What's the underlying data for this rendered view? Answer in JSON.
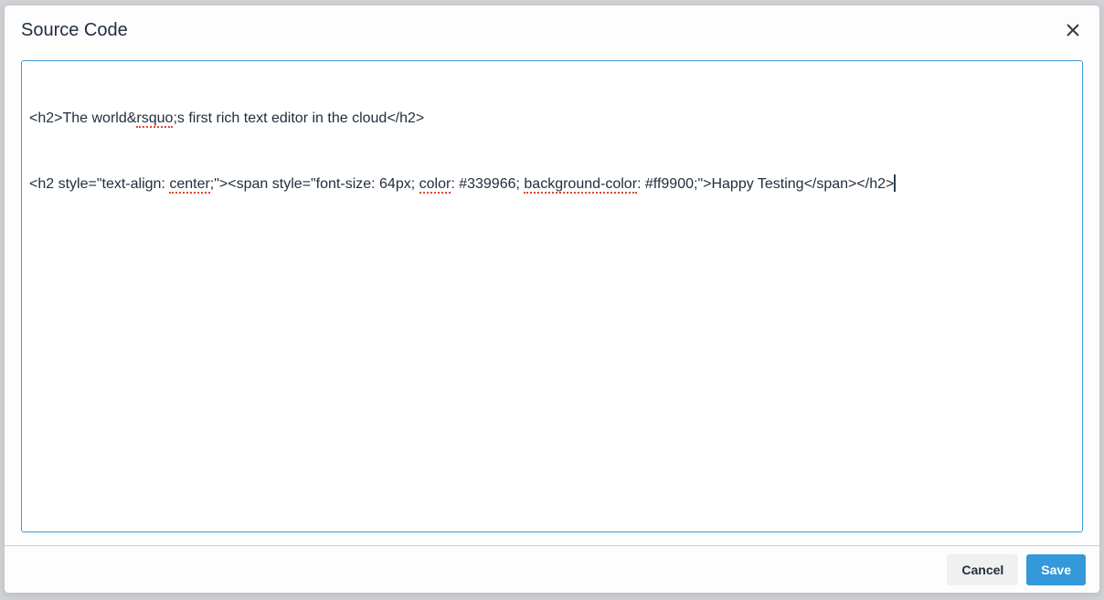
{
  "dialog": {
    "title": "Source Code",
    "close_icon": "✕"
  },
  "editor": {
    "lines": [
      {
        "segments": [
          {
            "text": "<h2>The world&",
            "misspelled": false
          },
          {
            "text": "rsquo",
            "misspelled": true
          },
          {
            "text": ";s first rich text editor in the cloud</h2>",
            "misspelled": false
          }
        ]
      },
      {
        "segments": [
          {
            "text": "<h2 style=\"text-align: ",
            "misspelled": false
          },
          {
            "text": "center",
            "misspelled": true
          },
          {
            "text": ";\"><span style=\"font-size: 64px; ",
            "misspelled": false
          },
          {
            "text": "color",
            "misspelled": true
          },
          {
            "text": ": #339966; ",
            "misspelled": false
          },
          {
            "text": "background-color",
            "misspelled": true
          },
          {
            "text": ": #ff9900;\">Happy Testing</span></h2>",
            "misspelled": false
          }
        ],
        "caret_at_end": true
      }
    ]
  },
  "footer": {
    "cancel_label": "Cancel",
    "save_label": "Save"
  },
  "colors": {
    "accent_blue": "#3498db",
    "focus_border": "#3f9ad8",
    "title_text": "#222f3e",
    "spellcheck_red": "#e0432e"
  }
}
